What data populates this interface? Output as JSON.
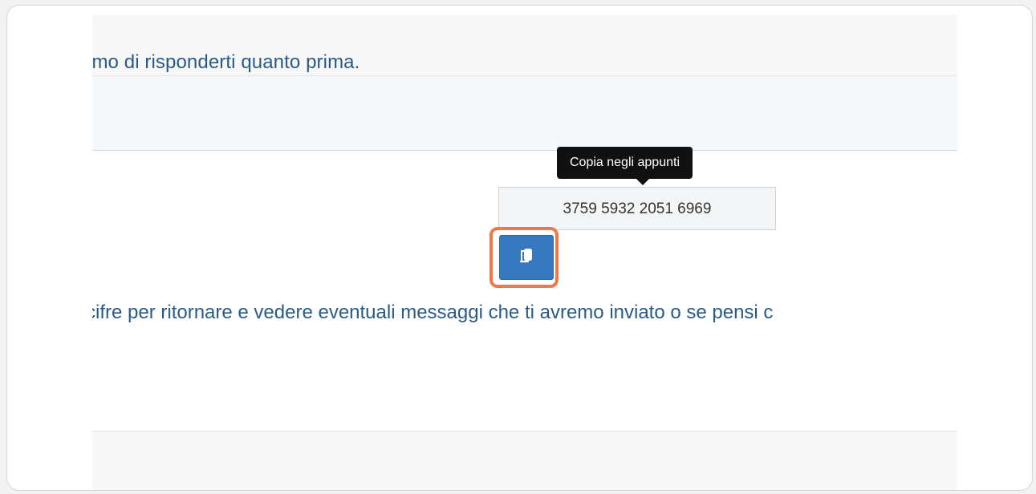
{
  "panel": {
    "intro_text": "emo di risponderti quanto prima.",
    "tooltip": "Copia negli appunti",
    "code_value": "3759 5932 2051 6969",
    "copy_button_icon": "copy-icon",
    "description_text": "cifre per ritornare e vedere eventuali messaggi che ti avremo inviato o se pensi c"
  },
  "colors": {
    "text_blue": "#2a5a86",
    "button_blue": "#3578c0",
    "highlight_orange": "#ec7a48",
    "tooltip_bg": "#111111"
  }
}
